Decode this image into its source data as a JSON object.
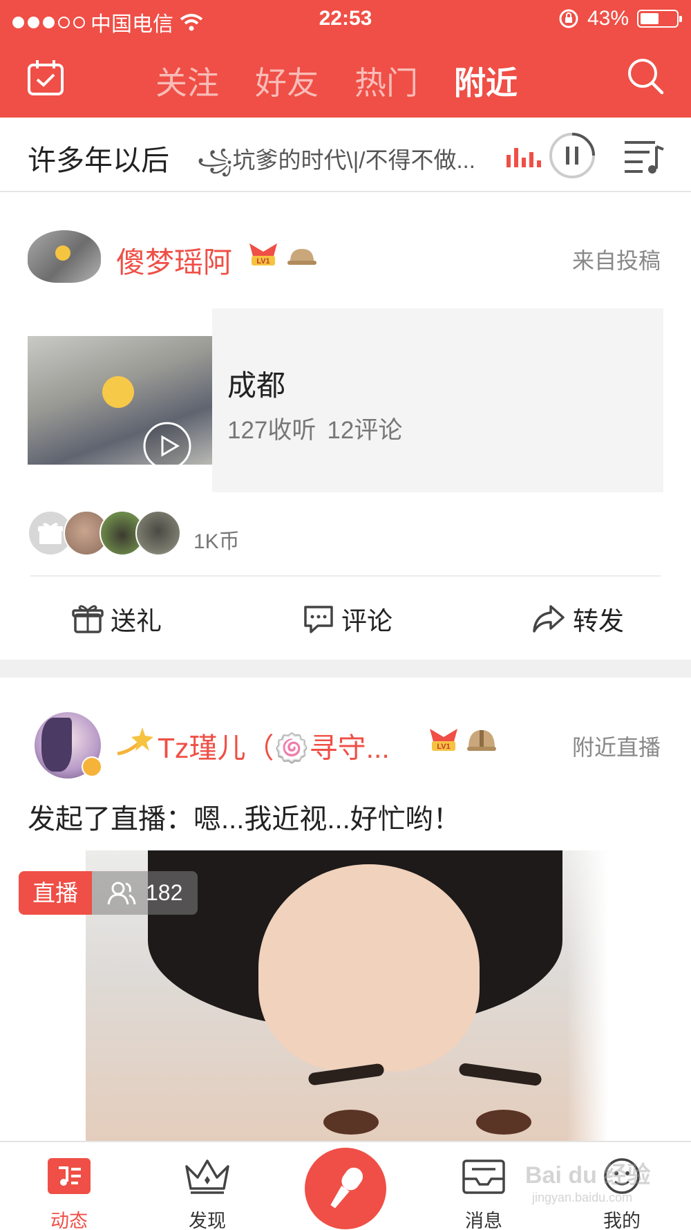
{
  "status_bar": {
    "carrier": "中国电信",
    "time": "22:53",
    "battery": "43%",
    "battery_level": 0.43
  },
  "header": {
    "tabs": [
      {
        "label": "关注",
        "active": false
      },
      {
        "label": "好友",
        "active": false
      },
      {
        "label": "热门",
        "active": false
      },
      {
        "label": "附近",
        "active": true
      }
    ],
    "left_icon": "calendar-check-icon",
    "right_icon": "search-icon",
    "accent_color": "#ef4f46"
  },
  "music_bar": {
    "song_title": "许多年以后",
    "lyric": "꧁坑爹的时代\\|/不得不做...",
    "play_state": "paused"
  },
  "post1": {
    "username": "傻梦瑶阿",
    "level_badge": "LV1",
    "source": "来自投稿",
    "card_title": "成都",
    "listens": "127收听",
    "comments": "12评论",
    "coins": "1K币",
    "actions": {
      "gift": "送礼",
      "comment": "评论",
      "share": "转发"
    }
  },
  "post2": {
    "username": "Tz瑾儿（🍥寻守...",
    "level_badge": "LV1",
    "source": "附近直播",
    "status_text": "发起了直播：嗯...我近视...好忙哟！",
    "live_label": "直播",
    "viewer_count": "182"
  },
  "tabbar": {
    "items": [
      {
        "label": "动态",
        "icon": "music-note-icon",
        "active": true
      },
      {
        "label": "发现",
        "icon": "crown-icon",
        "active": false
      },
      {
        "label": "",
        "icon": "microphone-icon",
        "active": false
      },
      {
        "label": "消息",
        "icon": "inbox-icon",
        "active": false
      },
      {
        "label": "我的",
        "icon": "profile-icon",
        "active": false
      }
    ],
    "watermark": "Bai du 经验",
    "watermark_sub": "jingyan.baidu.com"
  }
}
